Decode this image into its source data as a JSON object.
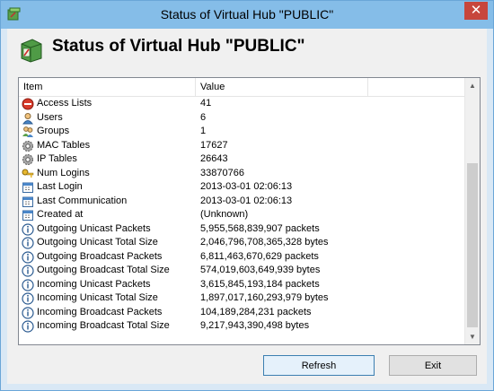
{
  "window": {
    "title": "Status of Virtual Hub \"PUBLIC\"",
    "close_label": "✕"
  },
  "header": {
    "title": "Status of Virtual Hub \"PUBLIC\""
  },
  "list": {
    "columns": [
      "Item",
      "Value",
      ""
    ],
    "rows": [
      {
        "icon": "no-entry-icon",
        "item": "Access Lists",
        "value": "41"
      },
      {
        "icon": "user-icon",
        "item": "Users",
        "value": "6"
      },
      {
        "icon": "group-icon",
        "item": "Groups",
        "value": "1"
      },
      {
        "icon": "gear-icon",
        "item": "MAC Tables",
        "value": "17627"
      },
      {
        "icon": "gear-icon",
        "item": "IP Tables",
        "value": "26643"
      },
      {
        "icon": "key-icon",
        "item": "Num Logins",
        "value": "33870766"
      },
      {
        "icon": "calendar-icon",
        "item": "Last Login",
        "value": "2013-03-01 02:06:13"
      },
      {
        "icon": "calendar-icon",
        "item": "Last Communication",
        "value": "2013-03-01 02:06:13"
      },
      {
        "icon": "calendar-icon",
        "item": "Created at",
        "value": "(Unknown)"
      },
      {
        "icon": "info-icon",
        "item": "Outgoing Unicast Packets",
        "value": "5,955,568,839,907 packets"
      },
      {
        "icon": "info-icon",
        "item": "Outgoing Unicast Total Size",
        "value": "2,046,796,708,365,328 bytes"
      },
      {
        "icon": "info-icon",
        "item": "Outgoing Broadcast Packets",
        "value": "6,811,463,670,629 packets"
      },
      {
        "icon": "info-icon",
        "item": "Outgoing Broadcast Total Size",
        "value": "574,019,603,649,939 bytes"
      },
      {
        "icon": "info-icon",
        "item": "Incoming Unicast Packets",
        "value": "3,615,845,193,184 packets"
      },
      {
        "icon": "info-icon",
        "item": "Incoming Unicast Total Size",
        "value": "1,897,017,160,293,979 bytes"
      },
      {
        "icon": "info-icon",
        "item": "Incoming Broadcast Packets",
        "value": "104,189,284,231 packets"
      },
      {
        "icon": "info-icon",
        "item": "Incoming Broadcast Total Size",
        "value": "9,217,943,390,498 bytes"
      }
    ]
  },
  "buttons": {
    "refresh": "Refresh",
    "exit": "Exit"
  }
}
